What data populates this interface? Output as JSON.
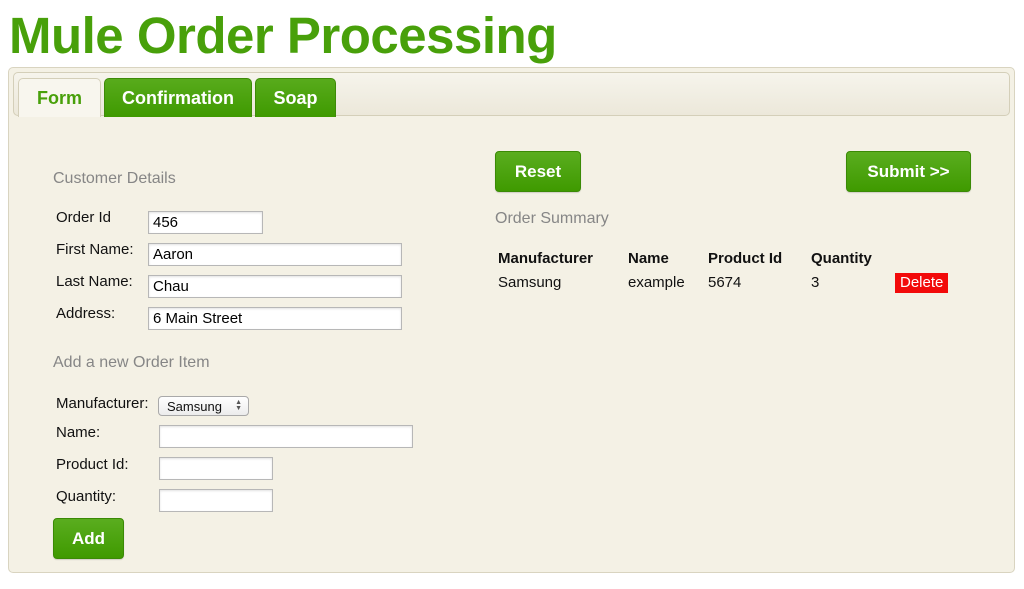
{
  "header": {
    "title": "Mule Order Processing"
  },
  "tabs": [
    {
      "label": "Form",
      "active": true
    },
    {
      "label": "Confirmation",
      "active": false
    },
    {
      "label": "Soap",
      "active": false
    }
  ],
  "customer": {
    "heading": "Customer Details",
    "order_id": {
      "label": "Order Id",
      "value": "456"
    },
    "first_name": {
      "label": "First Name:",
      "value": "Aaron"
    },
    "last_name": {
      "label": "Last Name:",
      "value": "Chau"
    },
    "address": {
      "label": "Address:",
      "value": "6 Main Street"
    }
  },
  "new_item": {
    "heading": "Add a new Order Item",
    "manufacturer": {
      "label": "Manufacturer:",
      "value": "Samsung"
    },
    "name": {
      "label": "Name:",
      "value": ""
    },
    "product_id": {
      "label": "Product Id:",
      "value": ""
    },
    "quantity": {
      "label": "Quantity:",
      "value": ""
    },
    "add_label": "Add"
  },
  "actions": {
    "reset_label": "Reset",
    "submit_label": "Submit >>"
  },
  "summary": {
    "heading": "Order Summary",
    "columns": [
      "Manufacturer",
      "Name",
      "Product Id",
      "Quantity"
    ],
    "rows": [
      {
        "manufacturer": "Samsung",
        "name": "example",
        "product_id": "5674",
        "quantity": "3",
        "delete_label": "Delete"
      }
    ]
  },
  "colors": {
    "brand_green": "#48a00a",
    "panel_bg": "#f4f1e5",
    "delete_red": "#f20a0a"
  }
}
